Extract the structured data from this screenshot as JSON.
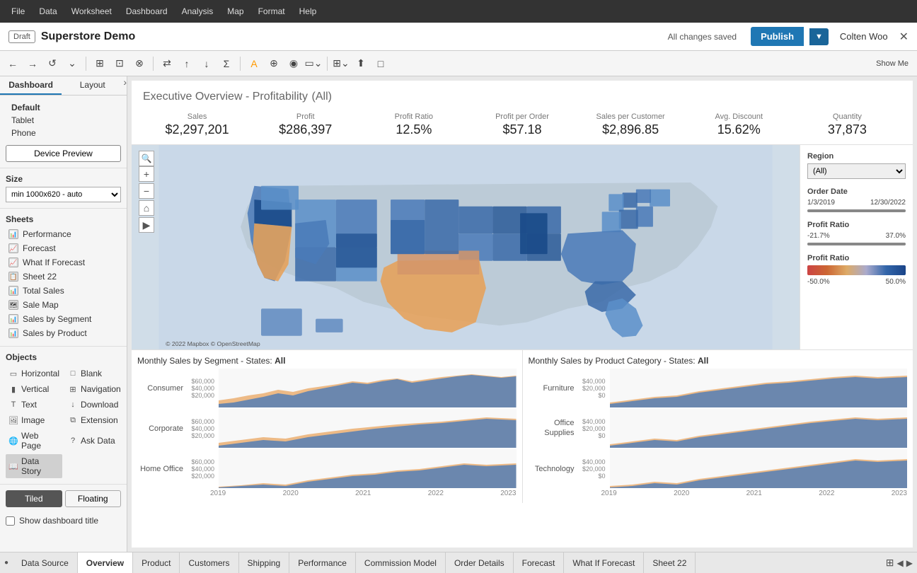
{
  "app": {
    "draft_label": "Draft",
    "workbook_title": "Superstore Demo",
    "saved_text": "All changes saved",
    "publish_label": "Publish",
    "user_name": "Colten Woo",
    "show_me_label": "Show Me"
  },
  "menu": {
    "items": [
      "File",
      "Data",
      "Worksheet",
      "Dashboard",
      "Analysis",
      "Map",
      "Format",
      "Help"
    ]
  },
  "sidebar": {
    "tabs": [
      "Dashboard",
      "Layout"
    ],
    "device_preview_label": "Device Preview",
    "devices": [
      {
        "label": "Default",
        "selected": true
      },
      {
        "label": "Tablet"
      },
      {
        "label": "Phone"
      }
    ],
    "size_label": "Size",
    "size_option": "min 1000x620 - auto",
    "sheets_label": "Sheets",
    "sheets": [
      "Performance",
      "Forecast",
      "What If Forecast",
      "Sheet 22",
      "Total Sales",
      "Sale Map",
      "Sales by Segment",
      "Sales by Product"
    ],
    "objects_label": "Objects",
    "objects": [
      {
        "label": "Horizontal",
        "icon": "▭"
      },
      {
        "label": "Blank",
        "icon": "□"
      },
      {
        "label": "Vertical",
        "icon": "▮"
      },
      {
        "label": "Navigation",
        "icon": "⊞"
      },
      {
        "label": "Text",
        "icon": "T"
      },
      {
        "label": "Download",
        "icon": "↓"
      },
      {
        "label": "Image",
        "icon": "🖼"
      },
      {
        "label": "Extension",
        "icon": "⧉"
      },
      {
        "label": "Web Page",
        "icon": "🌐"
      },
      {
        "label": "Ask Data",
        "icon": "?"
      },
      {
        "label": "Data Story",
        "icon": "📖"
      }
    ],
    "tiled_label": "Tiled",
    "floating_label": "Floating",
    "show_title_label": "Show dashboard title"
  },
  "dashboard": {
    "title": "Executive Overview - Profitability",
    "title_filter": "(All)",
    "kpis": [
      {
        "label": "Sales",
        "value": "$2,297,201"
      },
      {
        "label": "Profit",
        "value": "$286,397"
      },
      {
        "label": "Profit Ratio",
        "value": "12.5%"
      },
      {
        "label": "Profit per Order",
        "value": "$57.18"
      },
      {
        "label": "Sales per Customer",
        "value": "$2,896.85"
      },
      {
        "label": "Avg. Discount",
        "value": "15.62%"
      },
      {
        "label": "Quantity",
        "value": "37,873"
      }
    ]
  },
  "filters": {
    "region_label": "Region",
    "region_value": "(All)",
    "order_date_label": "Order Date",
    "date_start": "1/3/2019",
    "date_end": "12/30/2022",
    "profit_ratio_label": "Profit Ratio",
    "profit_ratio_min": "-21.7%",
    "profit_ratio_max": "37.0%",
    "color_legend_label": "Profit Ratio",
    "color_min": "-50.0%",
    "color_max": "50.0%"
  },
  "charts": {
    "left_title_prefix": "Monthly Sales by Segment - States:",
    "left_title_filter": "All",
    "right_title_prefix": "Monthly Sales by Product Category - States:",
    "right_title_filter": "All",
    "left_rows": [
      {
        "label": "Consumer",
        "y_labels": [
          "$60,000",
          "$40,000",
          "$20,000"
        ]
      },
      {
        "label": "Corporate",
        "y_labels": [
          "$60,000",
          "$40,000",
          "$20,000"
        ]
      },
      {
        "label": "Home Office",
        "y_labels": [
          "$60,000",
          "$40,000",
          "$20,000"
        ]
      }
    ],
    "right_rows": [
      {
        "label": "Furniture",
        "y_labels": [
          "$40,000",
          "$20,000",
          "$0"
        ]
      },
      {
        "label": "Office Supplies",
        "y_labels": [
          "$40,000",
          "$20,000",
          "$0"
        ]
      },
      {
        "label": "Technology",
        "y_labels": [
          "$40,000",
          "$20,000",
          "$0"
        ]
      }
    ],
    "x_labels_left": [
      "2019",
      "2020",
      "2021",
      "2022",
      "2023"
    ],
    "x_labels_right": [
      "2019",
      "2020",
      "2021",
      "2022",
      "2023"
    ]
  },
  "bottom_tabs": {
    "items": [
      {
        "label": "Data Source"
      },
      {
        "label": "Overview",
        "active": true
      },
      {
        "label": "Product"
      },
      {
        "label": "Customers"
      },
      {
        "label": "Shipping"
      },
      {
        "label": "Performance"
      },
      {
        "label": "Commission Model"
      },
      {
        "label": "Order Details"
      },
      {
        "label": "Forecast"
      },
      {
        "label": "What If Forecast"
      },
      {
        "label": "Sheet 22"
      }
    ]
  }
}
